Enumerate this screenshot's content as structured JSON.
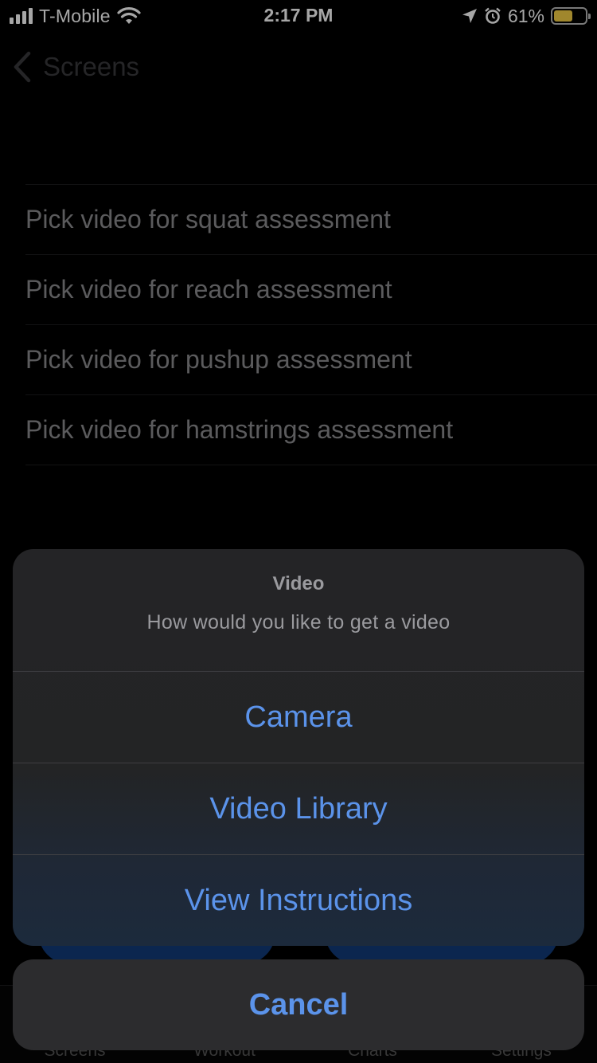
{
  "status_bar": {
    "carrier": "T-Mobile",
    "time": "2:17 PM",
    "battery_percent": "61%",
    "battery_level": 0.61
  },
  "nav": {
    "back_label": "Screens"
  },
  "list": {
    "items": [
      {
        "label": "Pick video for squat assessment"
      },
      {
        "label": "Pick video for reach assessment"
      },
      {
        "label": "Pick video for pushup assessment"
      },
      {
        "label": "Pick video for hamstrings assessment"
      }
    ]
  },
  "tabbar": {
    "tabs": [
      {
        "label": "Screens"
      },
      {
        "label": "Workout"
      },
      {
        "label": "Charts"
      },
      {
        "label": "Settings"
      }
    ]
  },
  "action_sheet": {
    "title": "Video",
    "message": "How would you like to get a video",
    "actions": [
      {
        "label": "Camera"
      },
      {
        "label": "Video Library"
      },
      {
        "label": "View Instructions"
      }
    ],
    "cancel_label": "Cancel"
  },
  "colors": {
    "accent": "#5b93ea",
    "battery": "#f6cf45"
  },
  "icons": [
    "signal-icon",
    "wifi-icon",
    "location-icon",
    "alarm-icon",
    "battery-icon",
    "back-chevron-icon"
  ]
}
